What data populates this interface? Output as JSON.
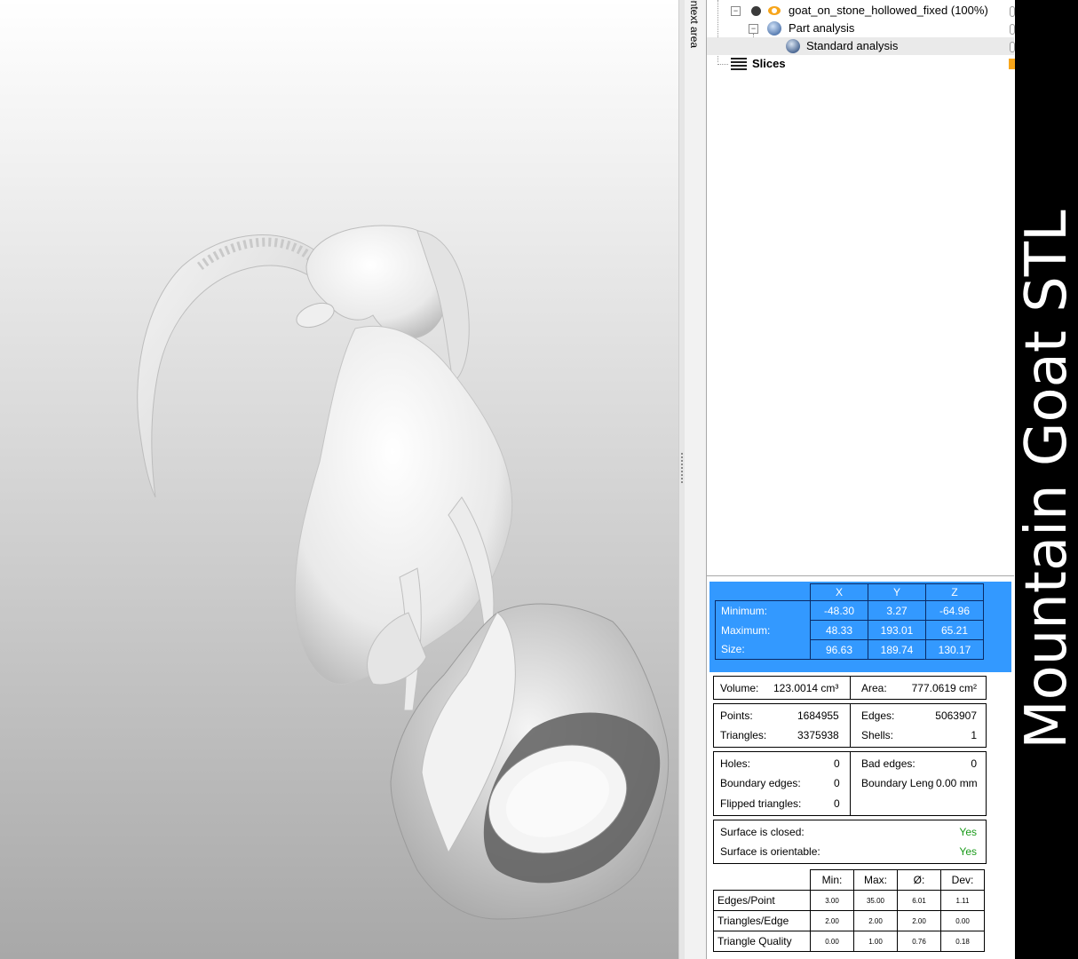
{
  "context_area_label": "ontext area",
  "banner_text": "Mountain Goat STL",
  "tree": {
    "part_label": "goat_on_stone_hollowed_fixed (100%)",
    "part_analysis_label": "Part analysis",
    "standard_analysis_label": "Standard analysis",
    "slices_label": "Slices"
  },
  "bbox": {
    "headers": [
      "X",
      "Y",
      "Z"
    ],
    "rows": [
      {
        "label": "Minimum:",
        "x": "-48.30",
        "y": "3.27",
        "z": "-64.96"
      },
      {
        "label": "Maximum:",
        "x": "48.33",
        "y": "193.01",
        "z": "65.21"
      },
      {
        "label": "Size:",
        "x": "96.63",
        "y": "189.74",
        "z": "130.17"
      }
    ]
  },
  "volume": {
    "label": "Volume:",
    "value": "123.0014 cm³"
  },
  "area": {
    "label": "Area:",
    "value": "777.0619 cm²"
  },
  "mesh": {
    "points_label": "Points:",
    "points": "1684955",
    "edges_label": "Edges:",
    "edges": "5063907",
    "triangles_label": "Triangles:",
    "triangles": "3375938",
    "shells_label": "Shells:",
    "shells": "1"
  },
  "defects": {
    "holes_label": "Holes:",
    "holes": "0",
    "bad_edges_label": "Bad edges:",
    "bad_edges": "0",
    "boundary_edges_label": "Boundary edges:",
    "boundary_edges": "0",
    "boundary_length_label": "Boundary Leng",
    "boundary_length": "0.00 mm",
    "flipped_label": "Flipped triangles:",
    "flipped": "0"
  },
  "surface": {
    "closed_label": "Surface is closed:",
    "closed": "Yes",
    "orientable_label": "Surface is orientable:",
    "orientable": "Yes"
  },
  "stats": {
    "headers": [
      "Min:",
      "Max:",
      "Ø:",
      "Dev:"
    ],
    "rows": [
      {
        "label": "Edges/Point",
        "values": [
          "3.00",
          "35.00",
          "6.01",
          "1.11"
        ]
      },
      {
        "label": "Triangles/Edge",
        "values": [
          "2.00",
          "2.00",
          "2.00",
          "0.00"
        ]
      },
      {
        "label": "Triangle Quality",
        "values": [
          "0.00",
          "1.00",
          "0.76",
          "0.18"
        ]
      }
    ]
  },
  "colors": {
    "selection_blue": "#3399ff",
    "ok_green": "#1a9a1a",
    "eye_orange": "#f7a51a"
  }
}
